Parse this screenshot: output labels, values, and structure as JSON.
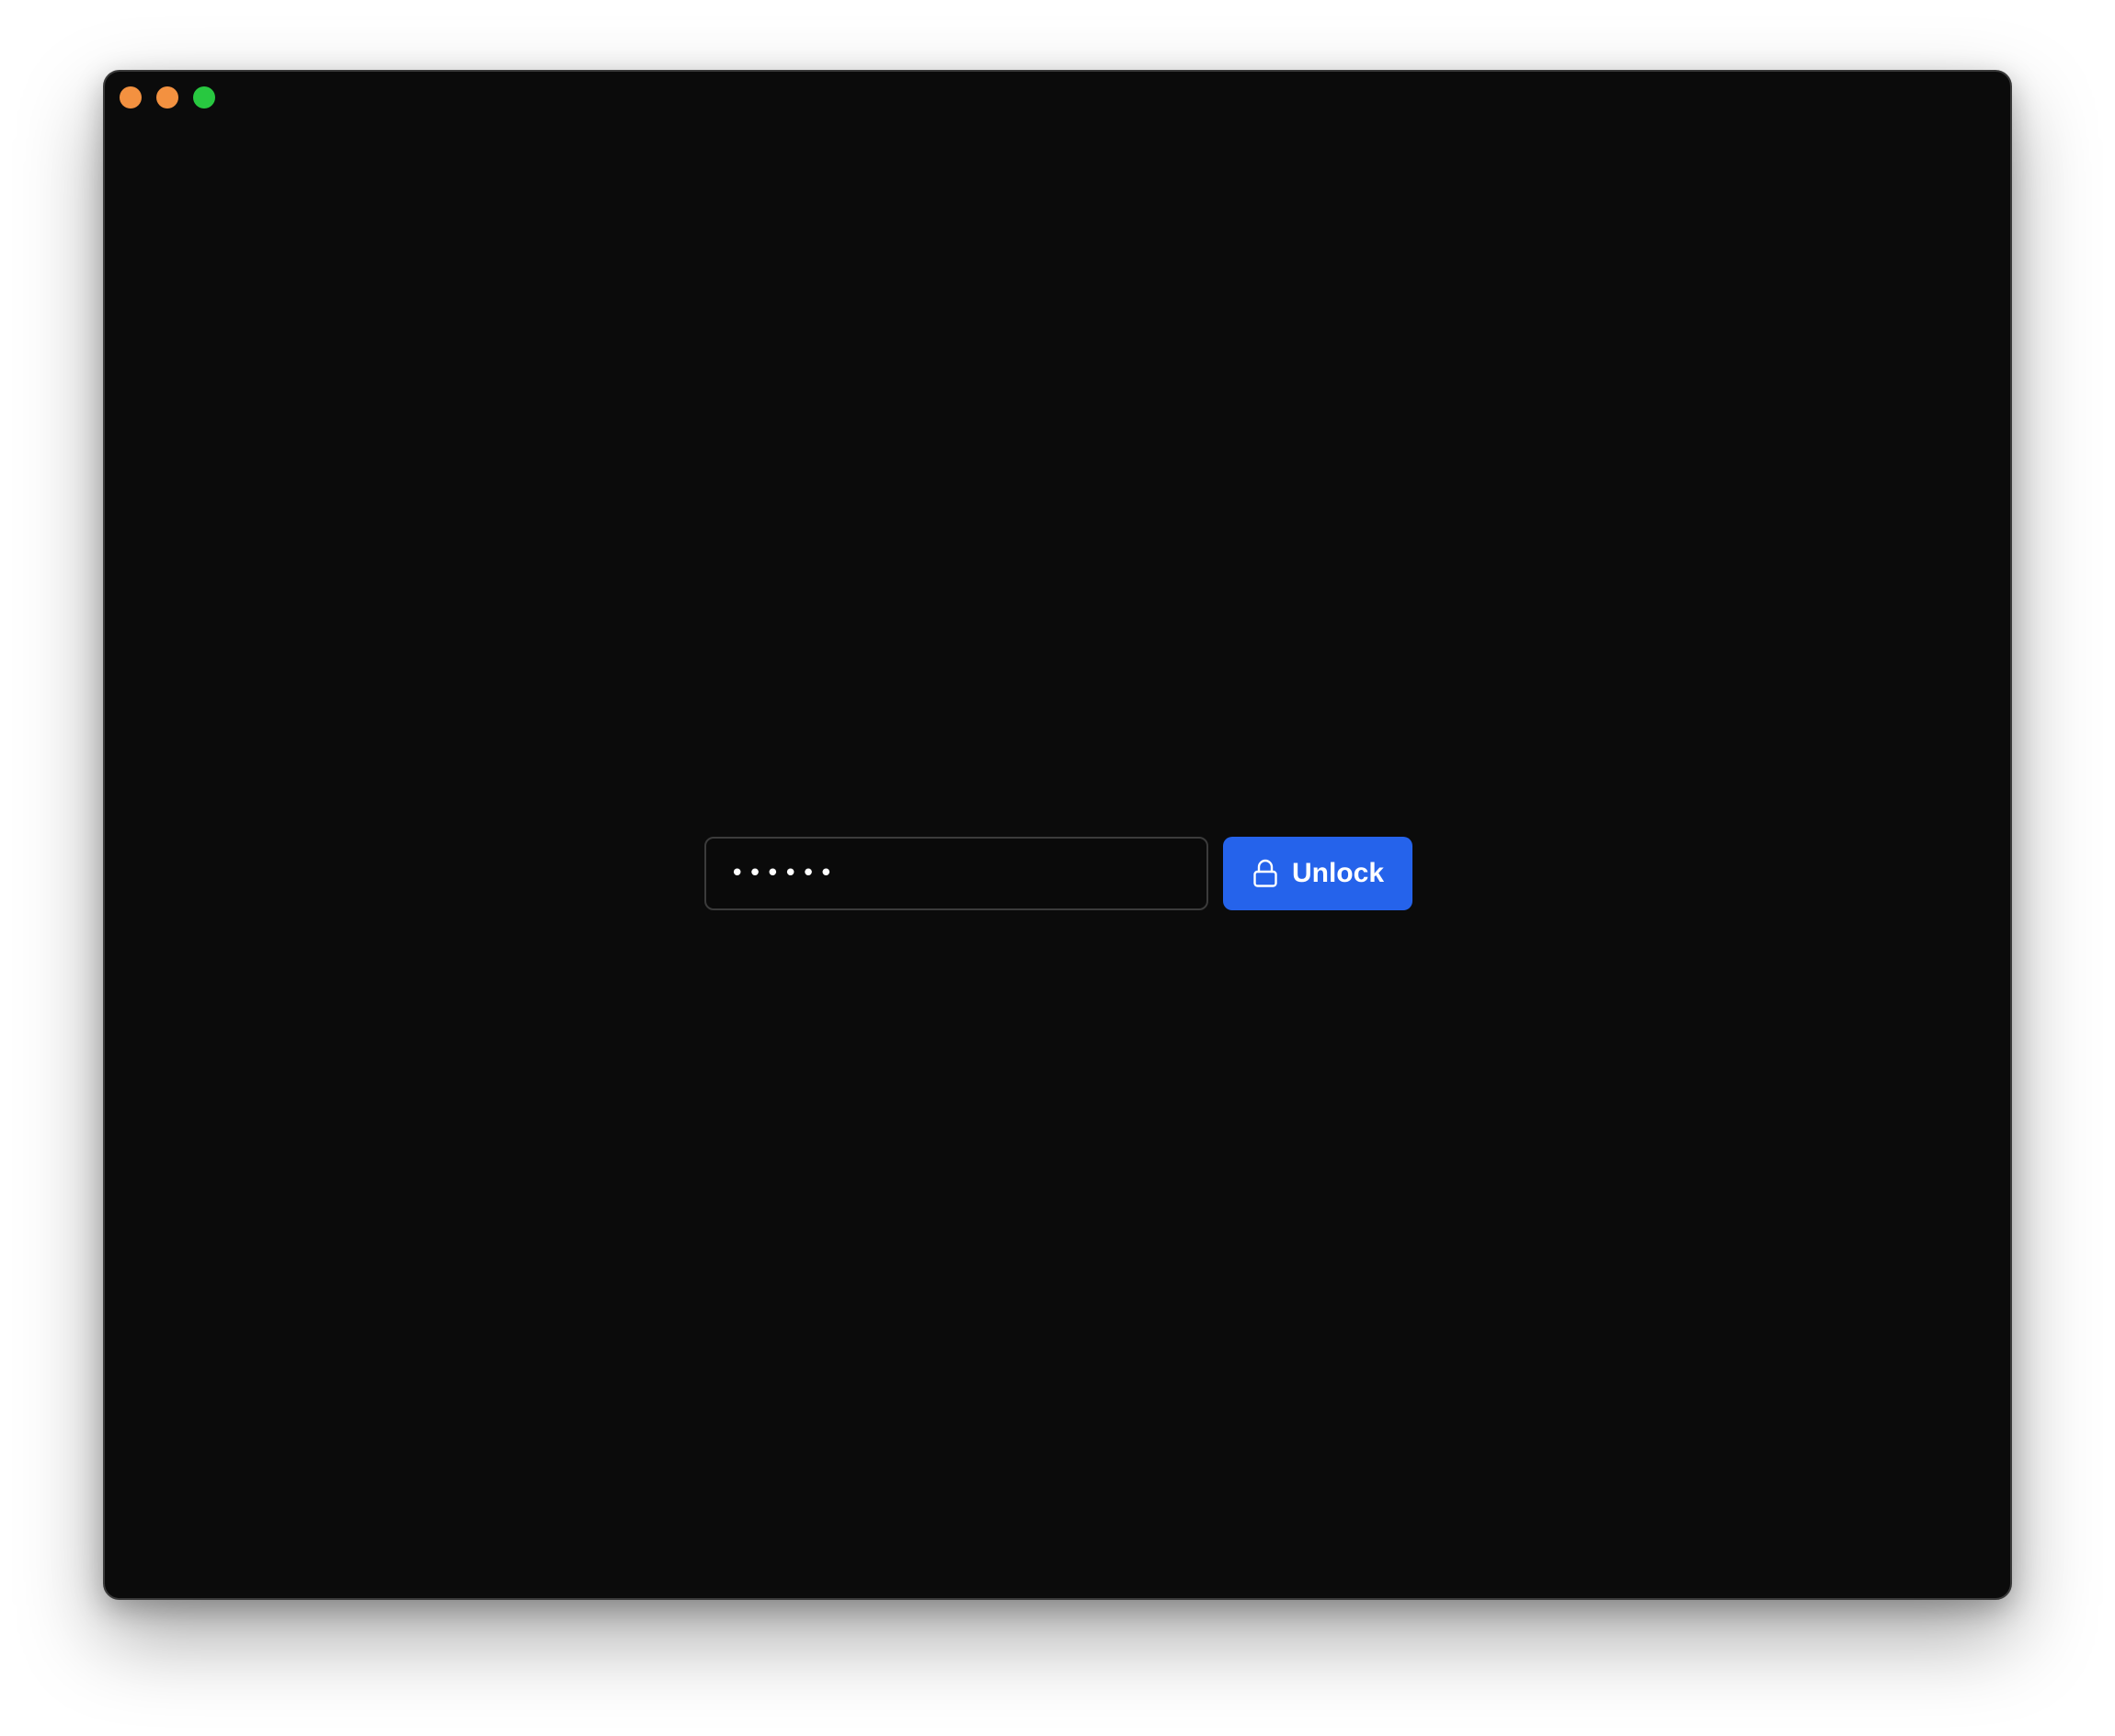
{
  "window": {
    "controls": [
      {
        "name": "close",
        "color": "#f39140"
      },
      {
        "name": "minimize",
        "color": "#f39140"
      },
      {
        "name": "zoom",
        "color": "#28c840"
      }
    ]
  },
  "unlock": {
    "password_value": "••••••",
    "button_label": "Unlock",
    "button_icon": "lock-icon",
    "accent_color": "#2563eb"
  }
}
